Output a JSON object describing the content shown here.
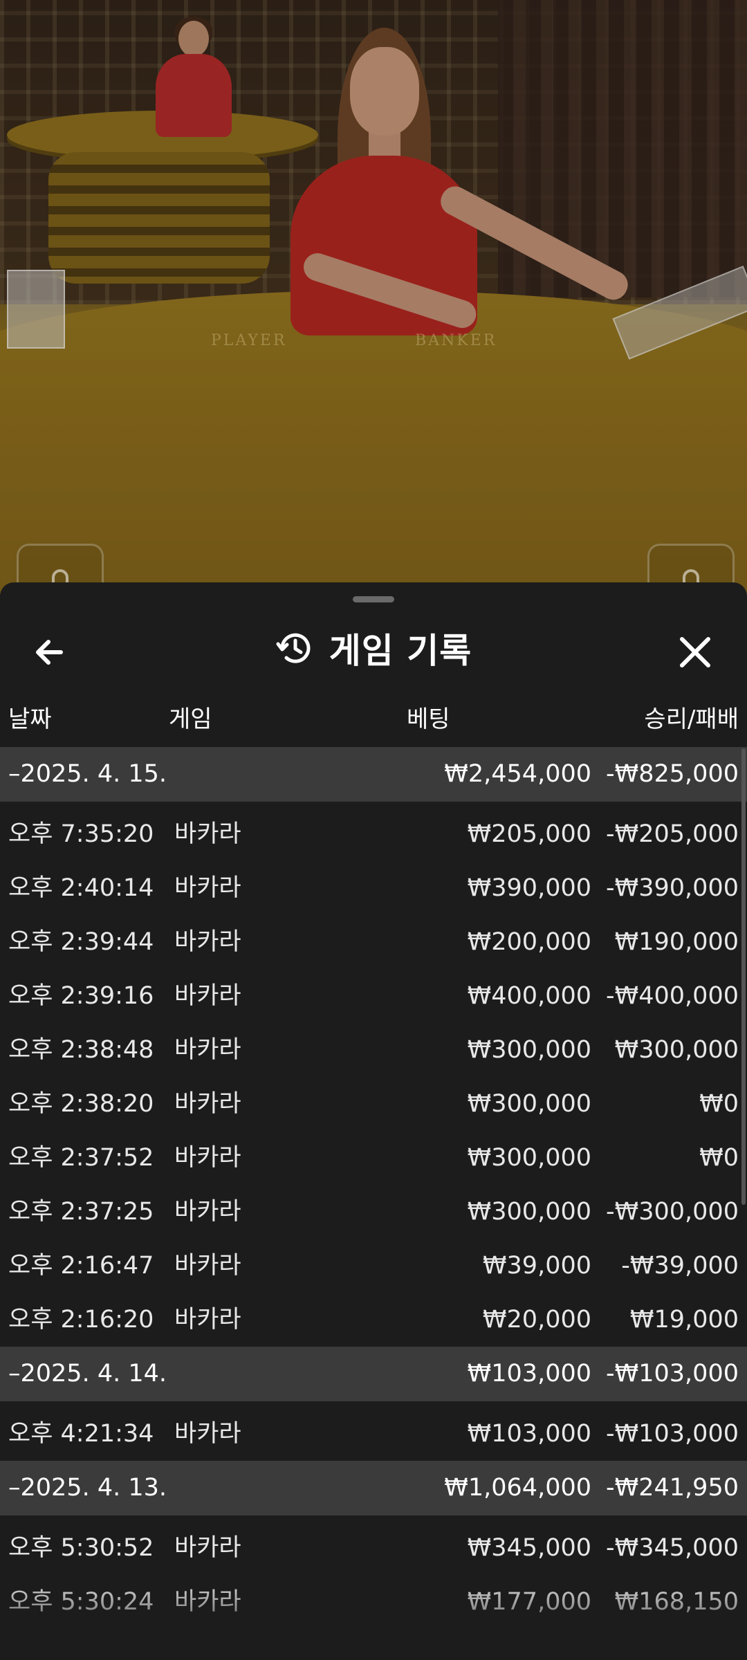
{
  "sheet": {
    "title": "게임 기록",
    "icons": {
      "back": "arrow-left-icon",
      "history": "history-clock-icon",
      "close": "close-icon"
    }
  },
  "columns": {
    "date": "날짜",
    "game": "게임",
    "bet": "베팅",
    "result": "승리/패배"
  },
  "groups": [
    {
      "date": "–2025. 4. 15.",
      "bet_total": "₩2,454,000",
      "result_total": "-₩825,000",
      "rows": [
        {
          "time": "오후 7:35:20",
          "game": "바카라",
          "bet": "₩205,000",
          "result": "-₩205,000"
        },
        {
          "time": "오후 2:40:14",
          "game": "바카라",
          "bet": "₩390,000",
          "result": "-₩390,000"
        },
        {
          "time": "오후 2:39:44",
          "game": "바카라",
          "bet": "₩200,000",
          "result": "₩190,000"
        },
        {
          "time": "오후 2:39:16",
          "game": "바카라",
          "bet": "₩400,000",
          "result": "-₩400,000"
        },
        {
          "time": "오후 2:38:48",
          "game": "바카라",
          "bet": "₩300,000",
          "result": "₩300,000"
        },
        {
          "time": "오후 2:38:20",
          "game": "바카라",
          "bet": "₩300,000",
          "result": "₩0"
        },
        {
          "time": "오후 2:37:52",
          "game": "바카라",
          "bet": "₩300,000",
          "result": "₩0"
        },
        {
          "time": "오후 2:37:25",
          "game": "바카라",
          "bet": "₩300,000",
          "result": "-₩300,000"
        },
        {
          "time": "오후 2:16:47",
          "game": "바카라",
          "bet": "₩39,000",
          "result": "-₩39,000"
        },
        {
          "time": "오후 2:16:20",
          "game": "바카라",
          "bet": "₩20,000",
          "result": "₩19,000"
        }
      ]
    },
    {
      "date": "–2025. 4. 14.",
      "bet_total": "₩103,000",
      "result_total": "-₩103,000",
      "rows": [
        {
          "time": "오후 4:21:34",
          "game": "바카라",
          "bet": "₩103,000",
          "result": "-₩103,000"
        }
      ]
    },
    {
      "date": "–2025. 4. 13.",
      "bet_total": "₩1,064,000",
      "result_total": "-₩241,950",
      "rows": [
        {
          "time": "오후 5:30:52",
          "game": "바카라",
          "bet": "₩345,000",
          "result": "-₩345,000"
        },
        {
          "time": "오후 5:30:24",
          "game": "바카라",
          "bet": "₩177,000",
          "result": "₩168,150"
        }
      ]
    }
  ],
  "video": {
    "table_labels": {
      "player": "PLAYER",
      "banker": "BANKER"
    }
  },
  "colors": {
    "sheet_bg": "#1c1c1c",
    "group_bg": "#3b3b3b",
    "text": "#ffffff"
  }
}
